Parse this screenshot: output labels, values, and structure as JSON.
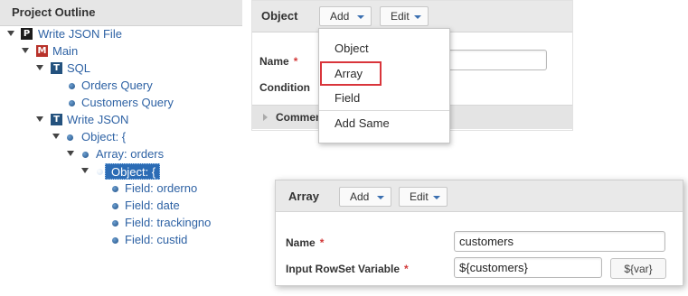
{
  "outline": {
    "title": "Project Outline",
    "nodes": [
      {
        "label": "Write JSON File",
        "icon": "P"
      },
      {
        "label": "Main",
        "icon": "M"
      },
      {
        "label": "SQL",
        "icon": "T"
      },
      {
        "label": "Orders Query"
      },
      {
        "label": "Customers Query"
      },
      {
        "label": "Write JSON",
        "icon": "T"
      },
      {
        "label": "Object: {"
      },
      {
        "label": "Array: orders"
      },
      {
        "label": "Object: {"
      },
      {
        "label": "Field: orderno"
      },
      {
        "label": "Field: date"
      },
      {
        "label": "Field: trackingno"
      },
      {
        "label": "Field: custid"
      }
    ]
  },
  "object_panel": {
    "title": "Object",
    "add_label": "Add",
    "edit_label": "Edit",
    "name_label": "Name",
    "condition_label": "Condition",
    "comments_label": "Comments",
    "required_marker": "*"
  },
  "add_menu": {
    "items": [
      "Object",
      "Array",
      "Field",
      "Add Same"
    ],
    "highlight_color": "#d9353b"
  },
  "array_panel": {
    "title": "Array",
    "add_label": "Add",
    "edit_label": "Edit",
    "name_label": "Name",
    "name_value": "customers",
    "rowset_label": "Input RowSet Variable",
    "rowset_value": "${customers}",
    "var_button": "${var}",
    "required_marker": "*"
  },
  "colors": {
    "link": "#2e62a4",
    "selected": "#2c6cb5",
    "required": "#d23a3a"
  }
}
